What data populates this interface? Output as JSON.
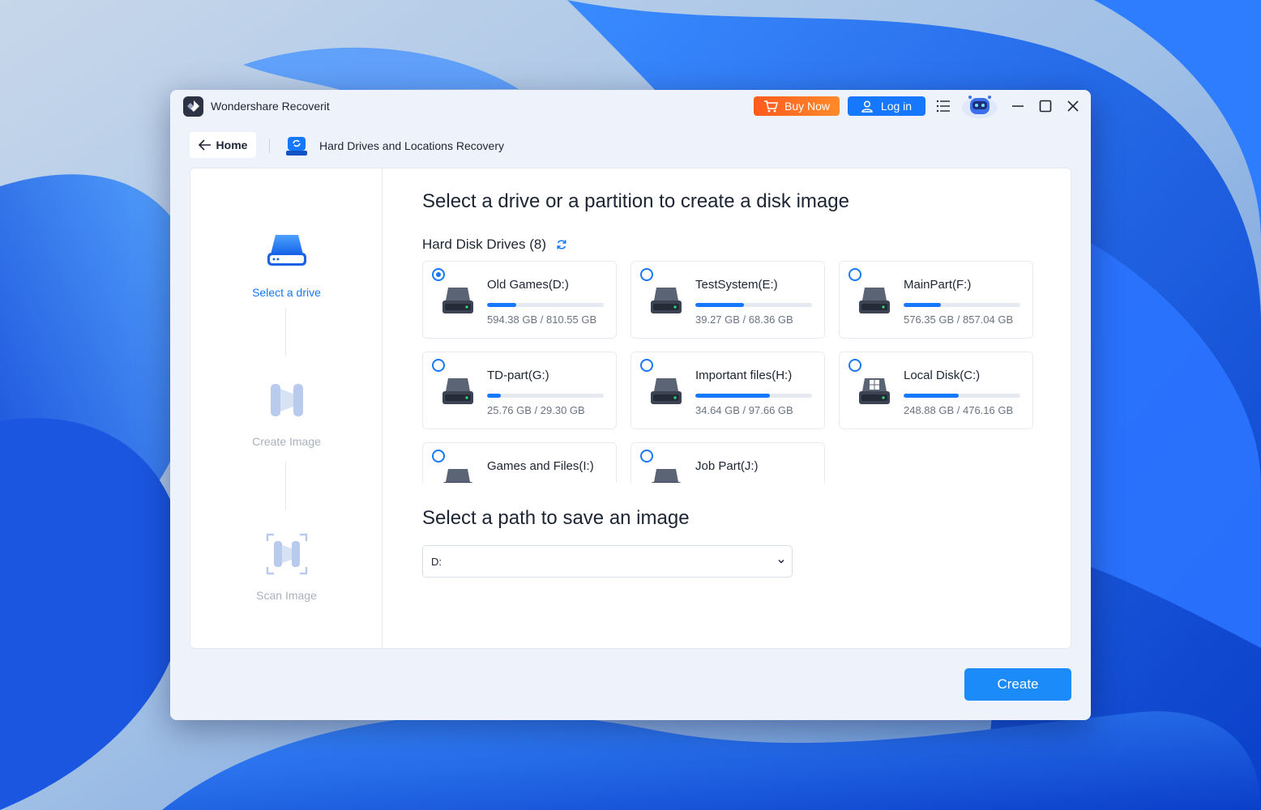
{
  "window": {
    "title": "Wondershare Recoverit",
    "buy_now_label": "Buy Now",
    "login_label": "Log in",
    "icons": [
      "app-logo-icon",
      "cart-icon",
      "user-icon",
      "menu-icon",
      "robot-avatar",
      "minimize-icon",
      "maximize-icon",
      "close-icon"
    ]
  },
  "nav": {
    "home_label": "Home",
    "page_title": "Hard Drives and Locations Recovery"
  },
  "steps": [
    {
      "label": "Select a drive",
      "state": "active"
    },
    {
      "label": "Create Image",
      "state": "inactive"
    },
    {
      "label": "Scan Image",
      "state": "inactive"
    }
  ],
  "main": {
    "heading": "Select a drive or a partition to create a disk image",
    "drives_heading": "Hard Disk Drives (8)",
    "drives": [
      {
        "name": "Old Games(D:)",
        "size": "594.38 GB / 810.55 GB",
        "used_fraction": 0.25,
        "selected": true,
        "icon": "hdd-icon"
      },
      {
        "name": "TestSystem(E:)",
        "size": "39.27 GB / 68.36 GB",
        "used_fraction": 0.42,
        "selected": false,
        "icon": "hdd-icon"
      },
      {
        "name": "MainPart(F:)",
        "size": "576.35 GB / 857.04 GB",
        "used_fraction": 0.32,
        "selected": false,
        "icon": "hdd-icon"
      },
      {
        "name": "TD-part(G:)",
        "size": "25.76 GB / 29.30 GB",
        "used_fraction": 0.12,
        "selected": false,
        "icon": "hdd-icon"
      },
      {
        "name": "Important files(H:)",
        "size": "34.64 GB / 97.66 GB",
        "used_fraction": 0.64,
        "selected": false,
        "icon": "hdd-icon"
      },
      {
        "name": "Local Disk(C:)",
        "size": "248.88 GB / 476.16 GB",
        "used_fraction": 0.47,
        "selected": false,
        "icon": "windows-hdd-icon"
      },
      {
        "name": "Games and Files(I:)",
        "size": "",
        "used_fraction": 0,
        "selected": false,
        "icon": "hdd-icon"
      },
      {
        "name": "Job Part(J:)",
        "size": "",
        "used_fraction": 0,
        "selected": false,
        "icon": "hdd-icon"
      }
    ],
    "save_heading": "Select a path to save an image",
    "save_path_value": "D:"
  },
  "footer": {
    "create_label": "Create"
  },
  "colors": {
    "accent": "#1677ff",
    "buy_now": "#ff6a22",
    "create": "#1b8bf9"
  }
}
